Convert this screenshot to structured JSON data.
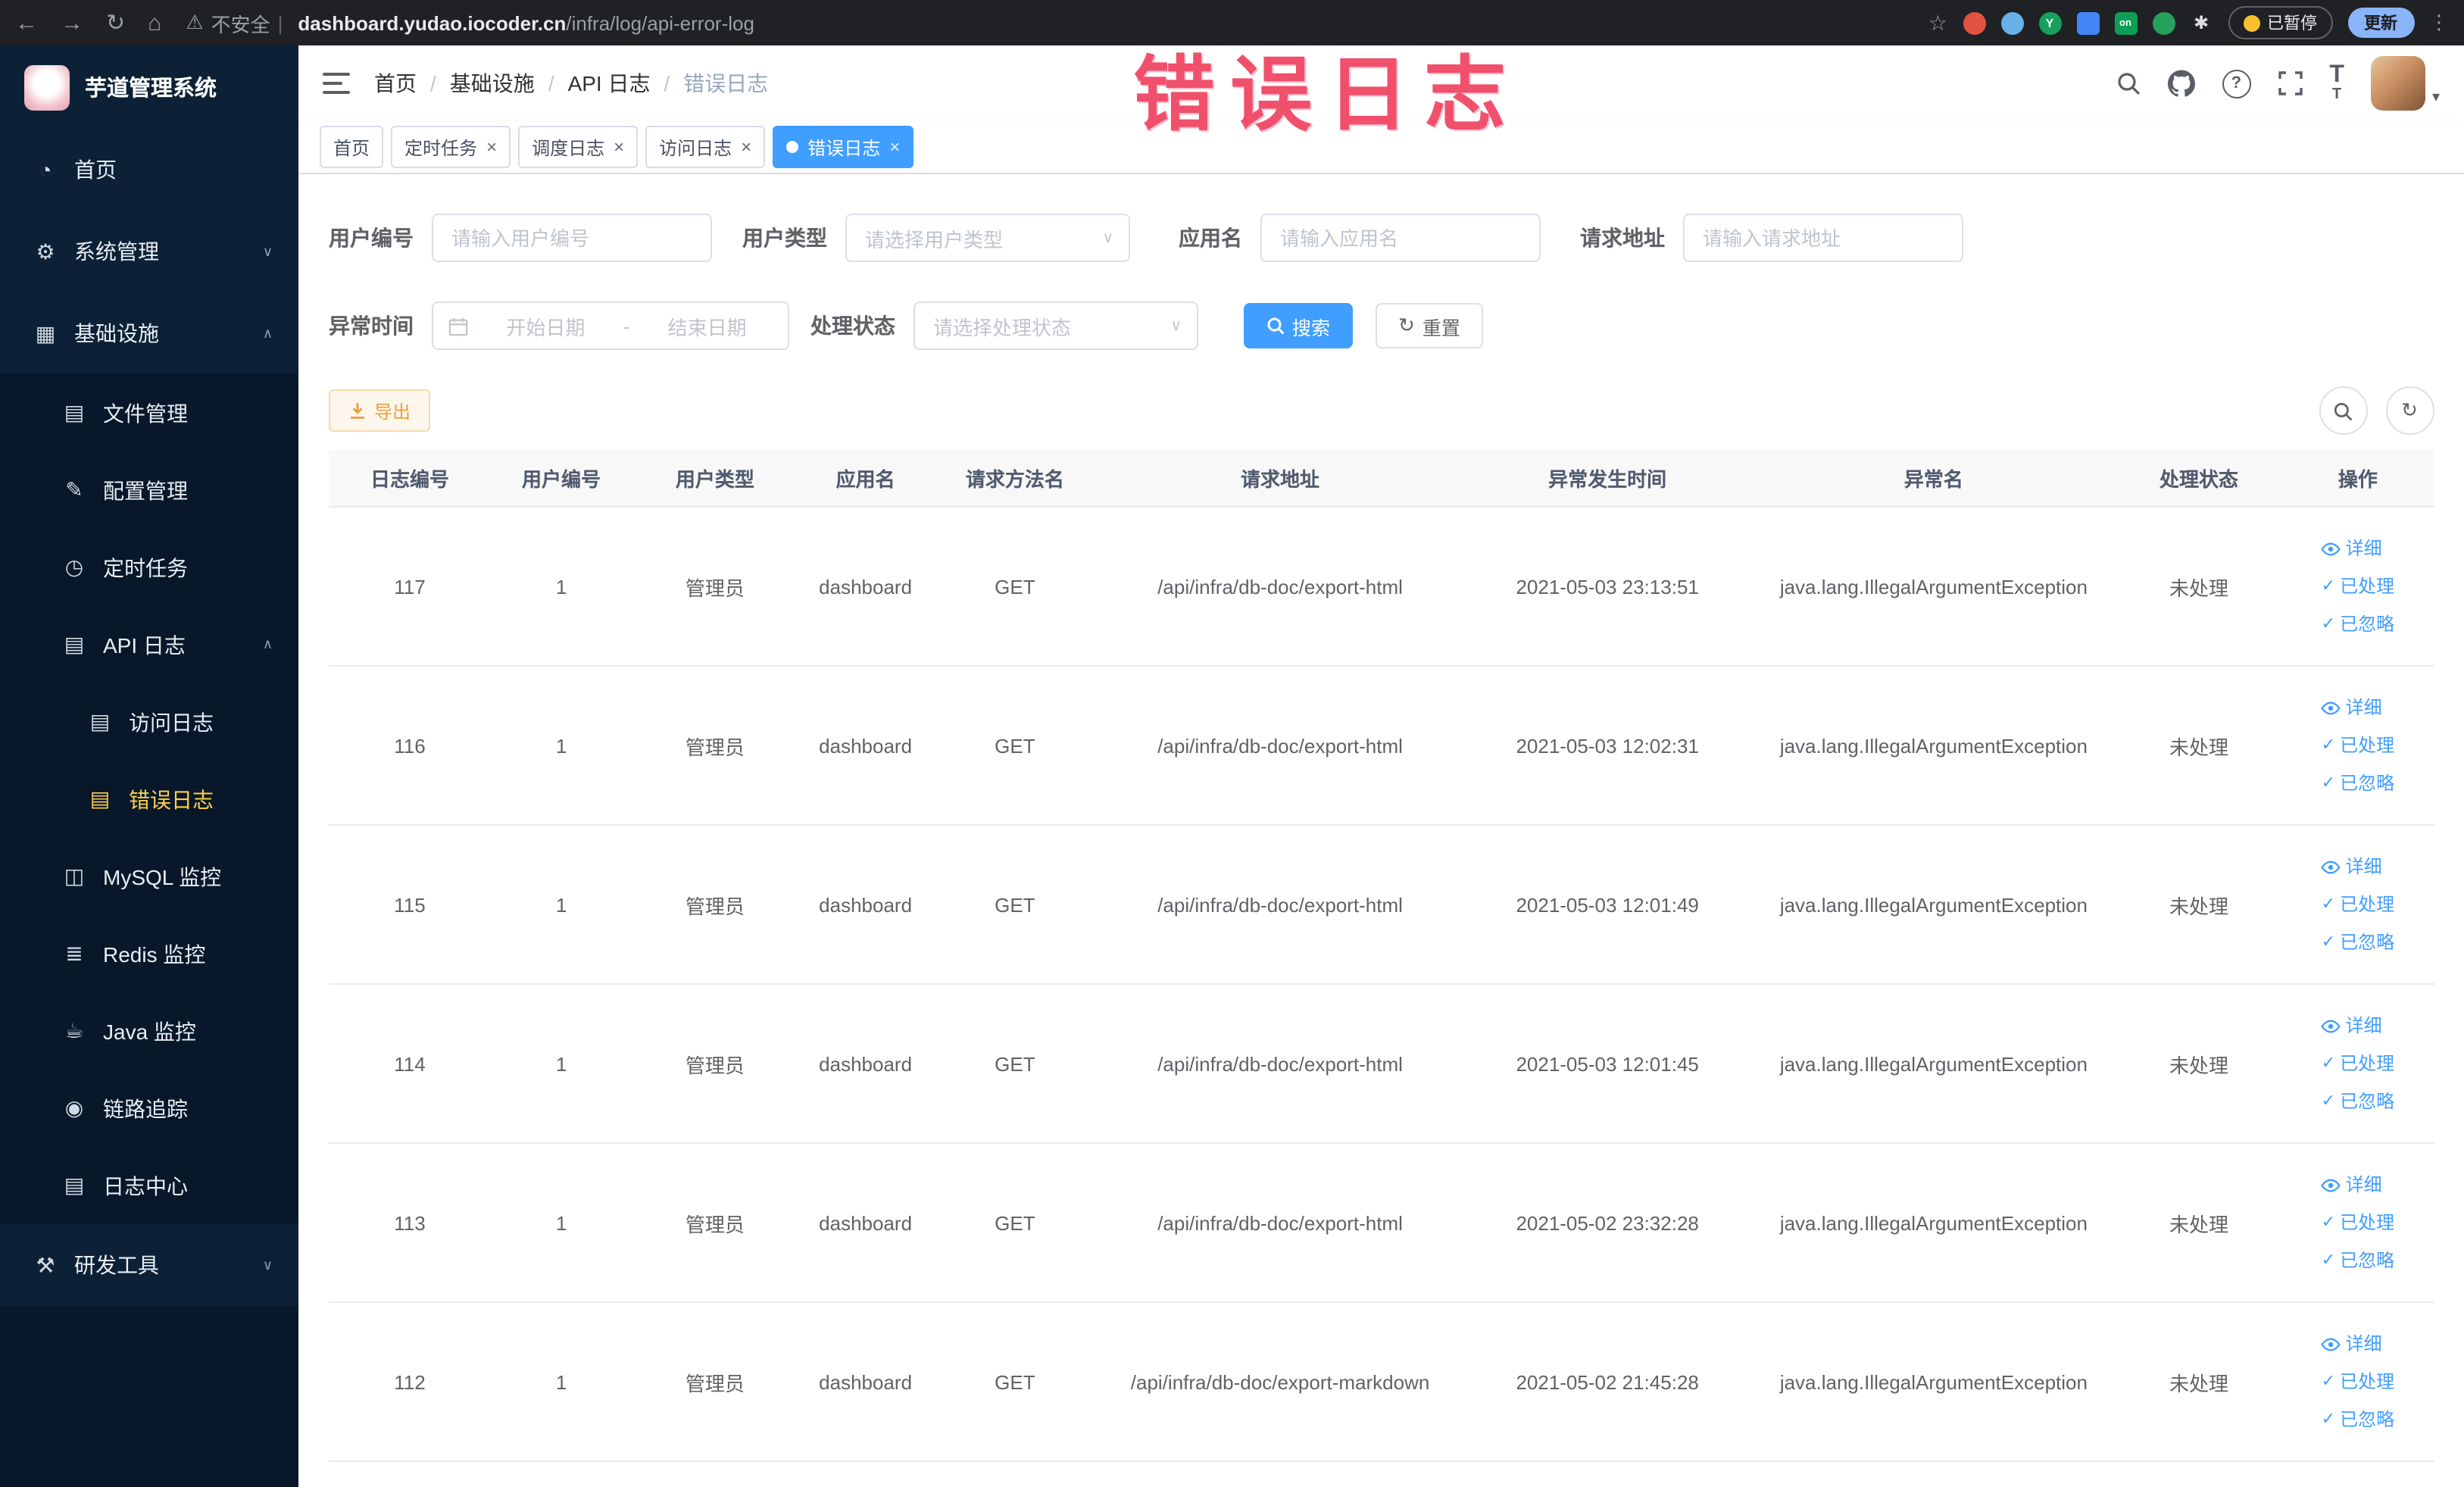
{
  "annotation": {
    "text": "错误日志"
  },
  "browser": {
    "security_label": "不安全",
    "url_domain": "dashboard.yudao.iocoder.cn",
    "url_path": "/infra/log/api-error-log",
    "extension_y_label": "Y",
    "extension_on_label": "on",
    "paused_badge": "已暂停",
    "update_button": "更新"
  },
  "sidebar": {
    "logo_title": "芋道管理系统",
    "items": [
      {
        "key": "home",
        "label": "首页",
        "level": 1,
        "icon": "dashboard"
      },
      {
        "key": "system",
        "label": "系统管理",
        "level": 1,
        "icon": "gear",
        "chevron": "down"
      },
      {
        "key": "infra",
        "label": "基础设施",
        "level": 1,
        "icon": "grid",
        "chevron": "up"
      },
      {
        "key": "file",
        "label": "文件管理",
        "level": 2,
        "icon": "folder"
      },
      {
        "key": "config",
        "label": "配置管理",
        "level": 2,
        "icon": "edit"
      },
      {
        "key": "job",
        "label": "定时任务",
        "level": 2,
        "icon": "clock"
      },
      {
        "key": "api-log",
        "label": "API 日志",
        "level": 2,
        "icon": "doc",
        "chevron": "up"
      },
      {
        "key": "access-log",
        "label": "访问日志",
        "level": 3,
        "icon": "doc"
      },
      {
        "key": "error-log",
        "label": "错误日志",
        "level": 3,
        "icon": "doc",
        "active": true
      },
      {
        "key": "mysql",
        "label": "MySQL 监控",
        "level": 2,
        "icon": "monitor"
      },
      {
        "key": "redis",
        "label": "Redis 监控",
        "level": 2,
        "icon": "layers"
      },
      {
        "key": "java",
        "label": "Java 监控",
        "level": 2,
        "icon": "coffee"
      },
      {
        "key": "trace",
        "label": "链路追踪",
        "level": 2,
        "icon": "eye"
      },
      {
        "key": "log-center",
        "label": "日志中心",
        "level": 2,
        "icon": "doc"
      },
      {
        "key": "dev-tools",
        "label": "研发工具",
        "level": 1,
        "icon": "tools",
        "chevron": "down"
      }
    ]
  },
  "header": {
    "breadcrumb": [
      "首页",
      "基础设施",
      "API 日志",
      "错误日志"
    ]
  },
  "tabs": [
    {
      "key": "home",
      "label": "首页",
      "closable": false,
      "active": false
    },
    {
      "key": "job",
      "label": "定时任务",
      "closable": true,
      "active": false
    },
    {
      "key": "job-log",
      "label": "调度日志",
      "closable": true,
      "active": false
    },
    {
      "key": "access-log",
      "label": "访问日志",
      "closable": true,
      "active": false
    },
    {
      "key": "error-log",
      "label": "错误日志",
      "closable": true,
      "active": true
    }
  ],
  "filters": {
    "user_id": {
      "label": "用户编号",
      "placeholder": "请输入用户编号"
    },
    "user_type": {
      "label": "用户类型",
      "placeholder": "请选择用户类型"
    },
    "app_name": {
      "label": "应用名",
      "placeholder": "请输入应用名"
    },
    "request_url": {
      "label": "请求地址",
      "placeholder": "请输入请求地址"
    },
    "exception_time": {
      "label": "异常时间",
      "start_placeholder": "开始日期",
      "separator": "-",
      "end_placeholder": "结束日期"
    },
    "process_status": {
      "label": "处理状态",
      "placeholder": "请选择处理状态"
    },
    "search_button": "搜索",
    "reset_button": "重置"
  },
  "toolbar": {
    "export_button": "导出"
  },
  "table": {
    "columns": [
      "日志编号",
      "用户编号",
      "用户类型",
      "应用名",
      "请求方法名",
      "请求地址",
      "异常发生时间",
      "异常名",
      "处理状态",
      "操作"
    ],
    "column_keys": [
      "log_id",
      "user_id",
      "user_type",
      "app",
      "method",
      "url",
      "time",
      "exception",
      "status"
    ],
    "actions": [
      {
        "key": "detail",
        "label": "详细",
        "icon": "eye"
      },
      {
        "key": "processed",
        "label": "已处理",
        "icon": "check"
      },
      {
        "key": "ignored",
        "label": "已忽略",
        "icon": "check"
      }
    ],
    "rows": [
      {
        "log_id": "117",
        "user_id": "1",
        "user_type": "管理员",
        "app": "dashboard",
        "method": "GET",
        "url": "/api/infra/db-doc/export-html",
        "time": "2021-05-03 23:13:51",
        "exception": "java.lang.IllegalArgumentException",
        "status": "未处理"
      },
      {
        "log_id": "116",
        "user_id": "1",
        "user_type": "管理员",
        "app": "dashboard",
        "method": "GET",
        "url": "/api/infra/db-doc/export-html",
        "time": "2021-05-03 12:02:31",
        "exception": "java.lang.IllegalArgumentException",
        "status": "未处理"
      },
      {
        "log_id": "115",
        "user_id": "1",
        "user_type": "管理员",
        "app": "dashboard",
        "method": "GET",
        "url": "/api/infra/db-doc/export-html",
        "time": "2021-05-03 12:01:49",
        "exception": "java.lang.IllegalArgumentException",
        "status": "未处理"
      },
      {
        "log_id": "114",
        "user_id": "1",
        "user_type": "管理员",
        "app": "dashboard",
        "method": "GET",
        "url": "/api/infra/db-doc/export-html",
        "time": "2021-05-03 12:01:45",
        "exception": "java.lang.IllegalArgumentException",
        "status": "未处理"
      },
      {
        "log_id": "113",
        "user_id": "1",
        "user_type": "管理员",
        "app": "dashboard",
        "method": "GET",
        "url": "/api/infra/db-doc/export-html",
        "time": "2021-05-02 23:32:28",
        "exception": "java.lang.IllegalArgumentException",
        "status": "未处理"
      },
      {
        "log_id": "112",
        "user_id": "1",
        "user_type": "管理员",
        "app": "dashboard",
        "method": "GET",
        "url": "/api/infra/db-doc/export-markdown",
        "time": "2021-05-02 21:45:28",
        "exception": "java.lang.IllegalArgumentException",
        "status": "未处理"
      }
    ]
  },
  "colors": {
    "accent": "#409eff",
    "menu_active": "#ffd04b",
    "warning": "#e6a23c",
    "annotation": "#f0506c"
  }
}
